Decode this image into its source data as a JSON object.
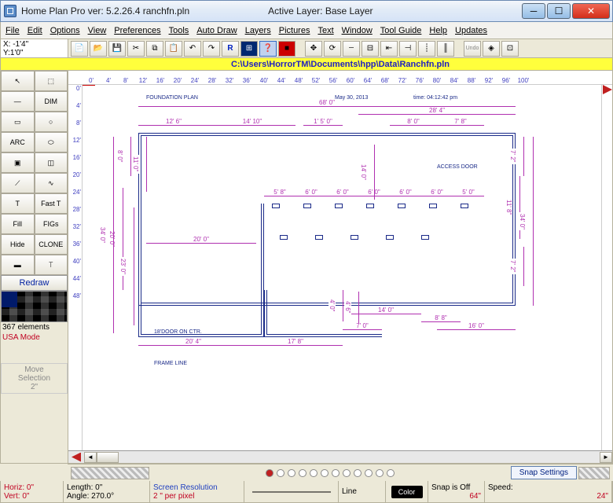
{
  "title": "Home Plan Pro ver: 5.2.26.4    ranchfn.pln",
  "active_layer": "Active Layer: Base Layer",
  "menu": [
    "File",
    "Edit",
    "Options",
    "View",
    "Preferences",
    "Tools",
    "Auto Draw",
    "Layers",
    "Pictures",
    "Text",
    "Window",
    "Tool Guide",
    "Help",
    "Updates"
  ],
  "coord_x": "X: -1'4\"",
  "coord_y": "Y:1'0\"",
  "filepath": "C:\\Users\\HorrorTM\\Documents\\hpp\\Data\\Ranchfn.pln",
  "ruler_h": [
    "0'",
    "4'",
    "8'",
    "12'",
    "16'",
    "20'",
    "24'",
    "28'",
    "32'",
    "36'",
    "40'",
    "44'",
    "48'",
    "52'",
    "56'",
    "60'",
    "64'",
    "68'",
    "72'",
    "76'",
    "80'",
    "84'",
    "88'",
    "92'",
    "96'",
    "100'"
  ],
  "ruler_v": [
    "0'",
    "4'",
    "8'",
    "12'",
    "16'",
    "20'",
    "24'",
    "28'",
    "32'",
    "36'",
    "40'",
    "44'",
    "48'"
  ],
  "tools": [
    {
      "name": "arrow",
      "label": "↖"
    },
    {
      "name": "select",
      "label": "⬚"
    },
    {
      "name": "line",
      "label": "—"
    },
    {
      "name": "dim",
      "label": "DIM"
    },
    {
      "name": "rect",
      "label": "▭"
    },
    {
      "name": "circle",
      "label": "○"
    },
    {
      "name": "arc",
      "label": "ARC"
    },
    {
      "name": "ellipse",
      "label": "⬭"
    },
    {
      "name": "window",
      "label": "▣"
    },
    {
      "name": "door",
      "label": "◫"
    },
    {
      "name": "poly",
      "label": "⟋"
    },
    {
      "name": "curve",
      "label": "∿"
    },
    {
      "name": "text",
      "label": "T"
    },
    {
      "name": "fast",
      "label": "Fast T"
    },
    {
      "name": "fill",
      "label": "Fill"
    },
    {
      "name": "figs",
      "label": "FIGs"
    },
    {
      "name": "hide",
      "label": "Hide"
    },
    {
      "name": "clone",
      "label": "CLONE"
    },
    {
      "name": "paint",
      "label": "▬"
    },
    {
      "name": "measure",
      "label": "⟙"
    }
  ],
  "redraw": "Redraw",
  "elements_count": "367 elements",
  "usa_mode": "USA Mode",
  "move_sel": "Move\nSelection\n2\"",
  "plan": {
    "title": "FOUNDATION PLAN",
    "date": "May 30, 2013",
    "time": "time: 04:12:42 pm",
    "frame": "FRAME LINE",
    "access": "ACCESS DOOR",
    "dims_top": [
      "68' 0\"",
      "28' 4\""
    ],
    "dims_top2": [
      "12' 6\"",
      "14' 10\"",
      "1' 5' 0\"",
      "8' 0\"",
      "7' 8\""
    ],
    "dims_mid": [
      "5' 8\"",
      "6' 0\"",
      "6' 0\"",
      "6' 0\"",
      "6' 0\"",
      "6' 0\"",
      "5' 0\""
    ],
    "dim_200": "20' 0\"",
    "dims_bot": [
      "20' 4\"",
      "17' 8\"",
      "7' 0\"",
      "14' 0\"",
      "8' 8\"",
      "16' 0\""
    ],
    "dims_left": [
      "8' 0\"",
      "11' 0\"",
      "20' 0\"",
      "34' 0\"",
      "23' 0\""
    ],
    "dims_right": [
      "7' 2\"",
      "11' 8\"",
      "34' 0\"",
      "7' 2\"",
      "14' 0\"",
      "4' 0\"",
      "4' 6\""
    ],
    "door_ctr": "18'DOOR ON CTR."
  },
  "pager": {
    "snap_label": "Snap Settings"
  },
  "status": {
    "horiz": "Horiz: 0\"",
    "vert": "Vert:  0\"",
    "length": "Length:  0\"",
    "angle": "Angle: 270.0°",
    "res_label": "Screen Resolution",
    "res_val": "2 \" per pixel",
    "line": "Line",
    "color": "Color",
    "snap": "Snap is Off",
    "snap_val": "64\"",
    "speed": "Speed:",
    "speed_val": "24\""
  }
}
